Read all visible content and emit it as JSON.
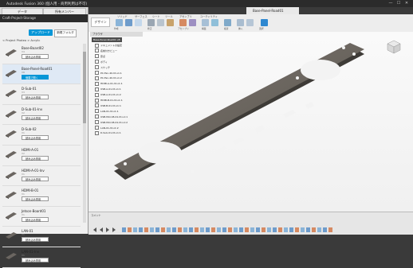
{
  "window": {
    "title": "Autodesk Fusion 360 (個人用 - 商用利用は不可)",
    "controls": [
      "—",
      "☐",
      "✕"
    ]
  },
  "leftpane": {
    "tabs": [
      "データ",
      "所有メンバー"
    ],
    "project": "Craft-Project-Storage",
    "upload_label": "アップロード",
    "newfolder_label": "新規フォルダ",
    "path": "< Project Photeo > Acrylic",
    "open_label": "読み込み専用",
    "open_label_selected": "個展で開く",
    "files": [
      {
        "name": "Base-Board02",
        "version": "V4"
      },
      {
        "name": "Base-Panel-Road01",
        "version": "V8",
        "selected": true
      },
      {
        "name": "D-Sub-01",
        "version": "V3"
      },
      {
        "name": "D-Sub-01-Inv",
        "version": "V2"
      },
      {
        "name": "D-Sub-02",
        "version": "V1"
      },
      {
        "name": "HDMI-A-01",
        "version": "V2"
      },
      {
        "name": "HDMI-A-01-Inv",
        "version": "V1"
      },
      {
        "name": "HDMI-B-01",
        "version": "V1"
      },
      {
        "name": "Jetson-Board01",
        "version": "V1"
      },
      {
        "name": "LAN-01",
        "version": "V1"
      },
      {
        "name": "LAN-01-Inv",
        "version": "V1"
      }
    ]
  },
  "document": {
    "tab_label": "Base-Panel-Road01"
  },
  "ribbon": {
    "workspace": "デザイン",
    "tabs": [
      "ソリッド",
      "サーフェス",
      "シート",
      "ツール",
      "アセンブリ",
      "ユーティリティ"
    ],
    "groups": [
      "作成",
      "修正",
      "アセンブリ",
      "構築",
      "検査",
      "挿入",
      "選択"
    ]
  },
  "browser": {
    "header": "ブラウザ",
    "root": "Base-Panel-Road01 v8",
    "items": [
      "ドキュメントの設定",
      "名前付きビュー",
      "原点",
      "ボディ",
      "スケッチ",
      "PC-Fan-40-ht-v1:1",
      "PC-Fan-40-ht-v1:2",
      "HDMI-A-01-ht-v1:1",
      "USB-A-01-ht-v1:1",
      "USB-A-01-ht-v1:2",
      "HDMI-B-01-ht-v1:1",
      "USB-B-01-ht-v1:1",
      "LAN-01-ht-v1:1",
      "USB-MicroB-01-ht-v1:1",
      "USB-MicroB-01-ht-v1:2",
      "LAN-01-ht-v1:2",
      "D-Sub-01-ht-v1:1"
    ]
  },
  "bottombar": {
    "comments": "コメント",
    "timeline_label": "タイムライン"
  },
  "colors": {
    "accent": "#0696d7",
    "panel": "#6a655f"
  }
}
